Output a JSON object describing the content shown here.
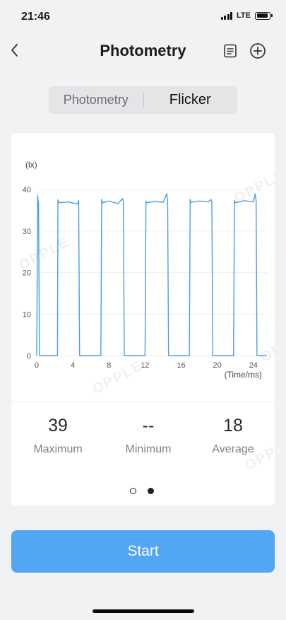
{
  "status": {
    "time": "21:46",
    "network": "LTE"
  },
  "nav": {
    "title": "Photometry"
  },
  "tabs": [
    {
      "label": "Photometry",
      "active": false
    },
    {
      "label": "Flicker",
      "active": true
    }
  ],
  "chart_data": {
    "type": "line",
    "ylabel": "(lx)",
    "xlabel": "(Time/ms)",
    "xlim": [
      0,
      25.5
    ],
    "ylim": [
      0,
      40
    ],
    "x_ticks": [
      "0",
      "4",
      "8",
      "12",
      "16",
      "20",
      "24"
    ],
    "y_ticks": [
      "0",
      "10",
      "20",
      "30",
      "40"
    ],
    "grid": true,
    "color": "#4a9ee8",
    "series": [
      {
        "x": [
          0,
          0.1,
          0.2,
          0.3,
          2.3,
          2.35,
          2.5,
          3.5,
          4.5,
          4.65,
          4.75,
          7.1,
          7.2,
          7.3,
          8.0,
          9.0,
          9.5,
          9.6,
          9.7,
          12.0,
          12.1,
          12.2,
          13.0,
          14.0,
          14.4,
          14.5,
          14.6,
          16.9,
          17.0,
          17.1,
          18.0,
          19.0,
          19.3,
          19.4,
          19.5,
          21.8,
          21.9,
          22.0,
          23.0,
          24.0,
          24.2,
          24.3,
          24.4,
          25.5
        ],
        "y": [
          0,
          38.5,
          36.5,
          0,
          0,
          37.5,
          36.8,
          37.0,
          36.5,
          37.3,
          0,
          0,
          37.6,
          36.8,
          37.2,
          36.6,
          37.8,
          37.0,
          0,
          0,
          37.2,
          36.8,
          37.1,
          36.9,
          39,
          37.0,
          0,
          0,
          37.6,
          36.9,
          37.2,
          37.0,
          37.6,
          37.0,
          0,
          0,
          37.4,
          36.8,
          37.3,
          37.0,
          39,
          37.2,
          0,
          0
        ]
      }
    ]
  },
  "stats": {
    "max_value": "39",
    "max_label": "Maximum",
    "min_value": "--",
    "min_label": "Minimum",
    "avg_value": "18",
    "avg_label": "Average"
  },
  "watermark": "OPPLE",
  "pager": {
    "count": 2,
    "active_index": 1
  },
  "start_label": "Start"
}
